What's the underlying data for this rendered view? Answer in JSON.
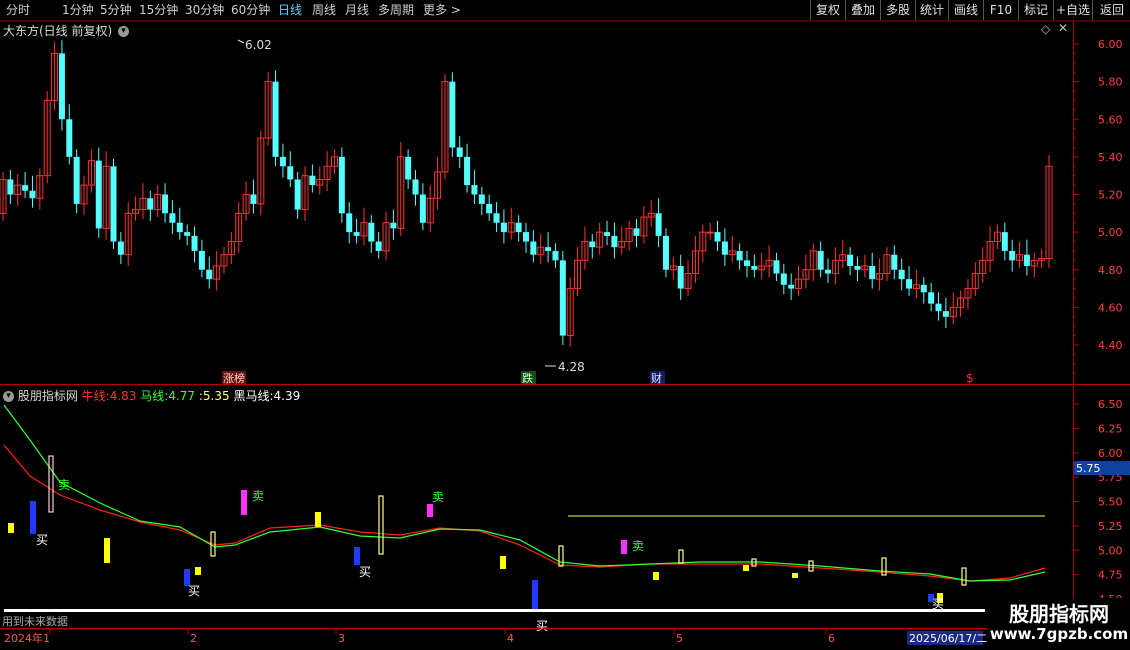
{
  "toolbar": {
    "periods": [
      "分时",
      "1分钟",
      "5分钟",
      "15分钟",
      "30分钟",
      "60分钟",
      "日线",
      "周线",
      "月线",
      "多周期",
      "更多 >"
    ],
    "active_period": "日线",
    "right_buttons": [
      "复权",
      "叠加",
      "多股",
      "统计",
      "画线",
      "F10",
      "标记",
      "+自选",
      "返回"
    ]
  },
  "main_panel": {
    "title": "大东方(日线 前复权)",
    "high_label": "6.02",
    "low_label": "4.28",
    "y_ticks": [
      "6.00",
      "5.80",
      "5.60",
      "5.40",
      "5.20",
      "5.00",
      "4.80",
      "4.60",
      "4.40"
    ],
    "markers": [
      "涨榜",
      "跌",
      "财",
      "$"
    ],
    "colors": {
      "up": "#ff3333",
      "down": "#54ffff",
      "grid": "#7a0000"
    }
  },
  "indicator_panel": {
    "name": "股朋指标网",
    "legend": [
      {
        "label": "牛线:",
        "value": "4.83",
        "color": "#ff3333"
      },
      {
        "label": "马线:",
        "value": "4.77",
        "color": "#33ff33"
      },
      {
        "label": ":",
        "value": "5.35",
        "color": "#ffff66"
      },
      {
        "label": "黑马线:",
        "value": "4.39",
        "color": "#ffffff"
      }
    ],
    "y_ticks": [
      "6.50",
      "6.25",
      "6.00",
      "5.75",
      "5.50",
      "5.25",
      "5.00",
      "4.75",
      "4.50"
    ],
    "current_value_tag": "5.75",
    "signal_buy": "买",
    "signal_sell": "卖",
    "future_data_note": "用到未来数据"
  },
  "x_axis": {
    "labels": [
      "2024年1",
      "2",
      "3",
      "4",
      "5",
      "6"
    ],
    "date_box": "2025/06/17/二"
  },
  "watermark": {
    "title": "股朋指标网",
    "url": "www.7gpzb.com"
  }
}
